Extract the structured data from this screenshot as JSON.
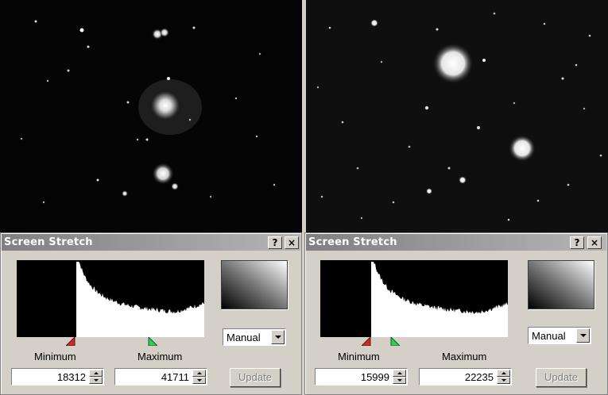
{
  "colors": {
    "dialog_bg": "#d4d0c8",
    "titlebar_start": "#808080",
    "titlebar_end": "#b5b5b5",
    "min_marker": "#cc2a2a",
    "max_marker": "#33cc55",
    "histogram": "#ffffff"
  },
  "dialogs": [
    {
      "title": "Screen Stretch",
      "help_label": "?",
      "close_label": "×",
      "minimum_label": "Minimum",
      "maximum_label": "Maximum",
      "minimum_value": "18312",
      "maximum_value": "41711",
      "mode": "Manual",
      "update_label": "Update"
    },
    {
      "title": "Screen Stretch",
      "help_label": "?",
      "close_label": "×",
      "minimum_label": "Minimum",
      "maximum_label": "Maximum",
      "minimum_value": "15999",
      "maximum_value": "22235",
      "mode": "Manual",
      "update_label": "Update"
    }
  ],
  "images": [
    {
      "icon": "astro-image-nebula"
    },
    {
      "icon": "astro-image-starfield"
    }
  ]
}
